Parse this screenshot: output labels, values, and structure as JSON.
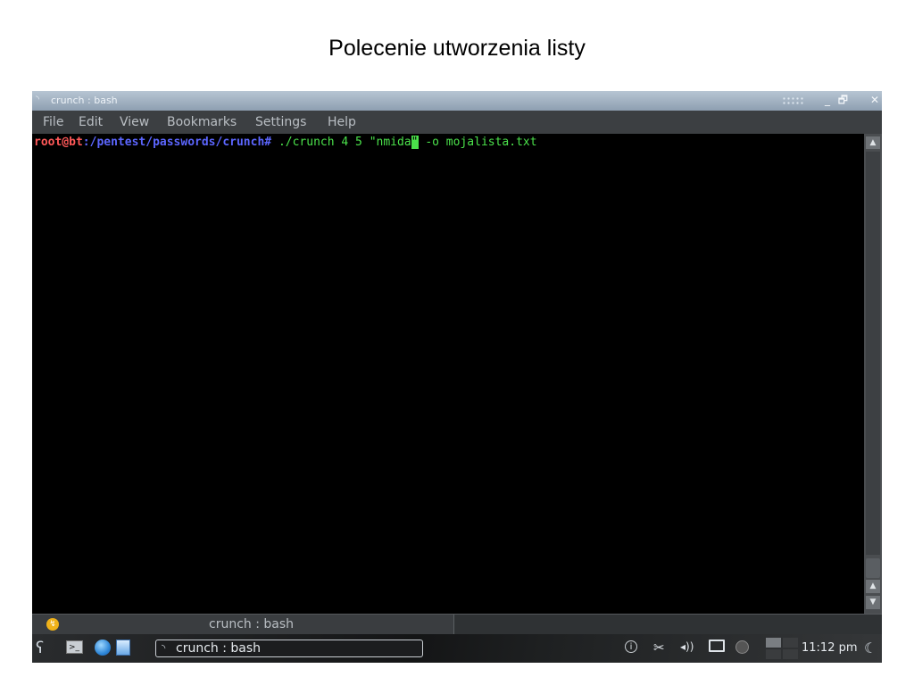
{
  "slide": {
    "title": "Polecenie utworzenia listy"
  },
  "window": {
    "title": "crunch : bash",
    "buttons": {
      "minimize": "_",
      "maximize": "🗗",
      "close": "✕"
    }
  },
  "menu": [
    "File",
    "Edit",
    "View",
    "Bookmarks",
    "Settings",
    "Help"
  ],
  "terminal": {
    "prompt_user": "root@bt",
    "prompt_sep": ":",
    "prompt_path": "/pentest/passwords/crunch",
    "prompt_symbol": "# ",
    "command_before_cursor": "./crunch 4 5 \"nmida",
    "cursor_char": "\"",
    "command_after_cursor": " -o mojalista.txt"
  },
  "tab": {
    "label": "crunch : bash"
  },
  "taskbar": {
    "task_label": "crunch : bash",
    "clock": "11:12 pm"
  },
  "colors": {
    "prompt_user": "#ff5858",
    "prompt_path": "#5c66ff",
    "command": "#4be24b",
    "terminal_bg": "#000000"
  },
  "icons": {
    "kmenu": "dragon-logo-icon",
    "terminal_launcher": "terminal-icon",
    "browser": "globe-icon",
    "file_manager": "folder-icon",
    "tray": [
      "info-icon",
      "scissors-icon",
      "volume-icon",
      "network-icon",
      "update-icon"
    ],
    "moon": "moon-icon"
  }
}
